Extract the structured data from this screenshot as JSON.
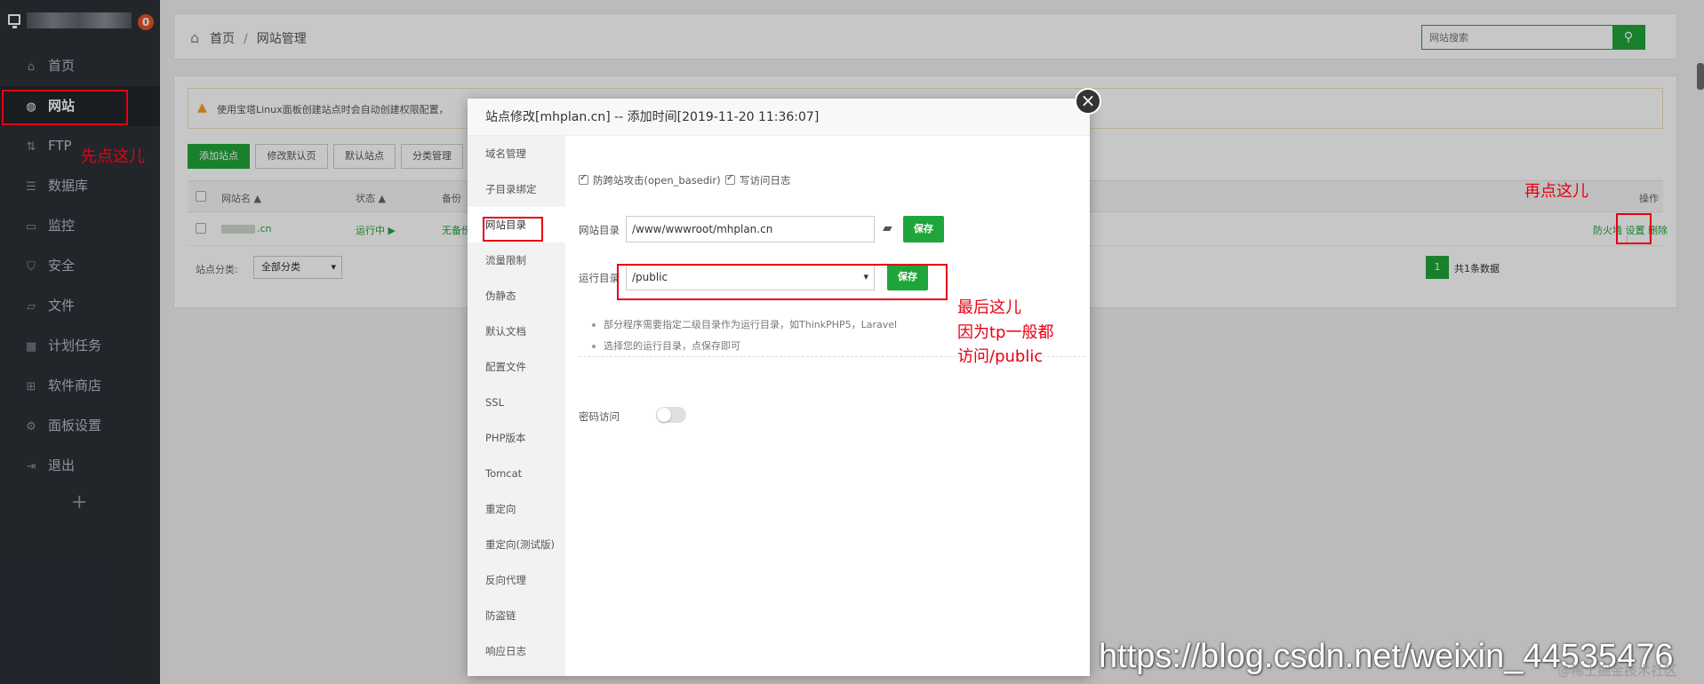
{
  "sidebar": {
    "badge": "0",
    "items": [
      {
        "label": "首页",
        "icon": "home-icon"
      },
      {
        "label": "网站",
        "icon": "globe-icon"
      },
      {
        "label": "FTP",
        "icon": "ftp-icon"
      },
      {
        "label": "数据库",
        "icon": "database-icon"
      },
      {
        "label": "监控",
        "icon": "monitor-icon"
      },
      {
        "label": "安全",
        "icon": "shield-icon"
      },
      {
        "label": "文件",
        "icon": "folder-icon"
      },
      {
        "label": "计划任务",
        "icon": "calendar-icon"
      },
      {
        "label": "软件商店",
        "icon": "apps-icon"
      },
      {
        "label": "面板设置",
        "icon": "gear-icon"
      },
      {
        "label": "退出",
        "icon": "logout-icon"
      }
    ],
    "add": "+"
  },
  "breadcrumb": {
    "home": "首页",
    "sep": "/",
    "current": "网站管理"
  },
  "search": {
    "placeholder": "网站搜索"
  },
  "warning": {
    "text": "使用宝塔Linux面板创建站点时会自动创建权限配置，"
  },
  "toolbar": {
    "buttons": [
      "添加站点",
      "修改默认页",
      "默认站点",
      "分类管理"
    ]
  },
  "table": {
    "headers": {
      "name": "网站名 ▲",
      "status": "状态 ▲",
      "backup": "备份",
      "ops": "操作"
    },
    "row": {
      "name": ".cn",
      "status": "运行中 ▶",
      "backup": "无备份",
      "firewall": "防火墙",
      "settings": "设置",
      "sep": "|",
      "delete": "删除"
    }
  },
  "footer": {
    "category_label": "站点分类:",
    "category_value": "全部分类",
    "page": "1",
    "total": "共1条数据"
  },
  "dialog": {
    "title": "站点修改[mhplan.cn] -- 添加时间[2019-11-20 11:36:07]",
    "close": "×",
    "nav": [
      "域名管理",
      "子目录绑定",
      "网站目录",
      "流量限制",
      "伪静态",
      "默认文档",
      "配置文件",
      "SSL",
      "PHP版本",
      "Tomcat",
      "重定向",
      "重定向(测试版)",
      "反向代理",
      "防盗链",
      "响应日志"
    ],
    "active_nav": "网站目录",
    "check_basedir": "防跨站攻击(open_basedir)",
    "check_log": "写访问日志",
    "site_dir_label": "网站目录",
    "site_dir_value": "/www/wwwroot/mhplan.cn",
    "run_dir_label": "运行目录",
    "run_dir_value": "/public",
    "save": "保存",
    "tip1": "部分程序需要指定二级目录作为运行目录，如ThinkPHP5，Laravel",
    "tip2": "选择您的运行目录，点保存即可",
    "password_label": "密码访问",
    "password_enabled": false
  },
  "annotations": {
    "first": "先点这儿",
    "second": "再点这儿",
    "last1": "最后这儿",
    "last2": "因为tp一般都",
    "last3": "访问/public"
  },
  "watermark": "https://blog.csdn.net/weixin_44535476",
  "watermark2": "@稀土掘金技术社区",
  "colors": {
    "accent": "#20a53a",
    "sidebar": "#2c3138",
    "annotation": "#e60012"
  }
}
